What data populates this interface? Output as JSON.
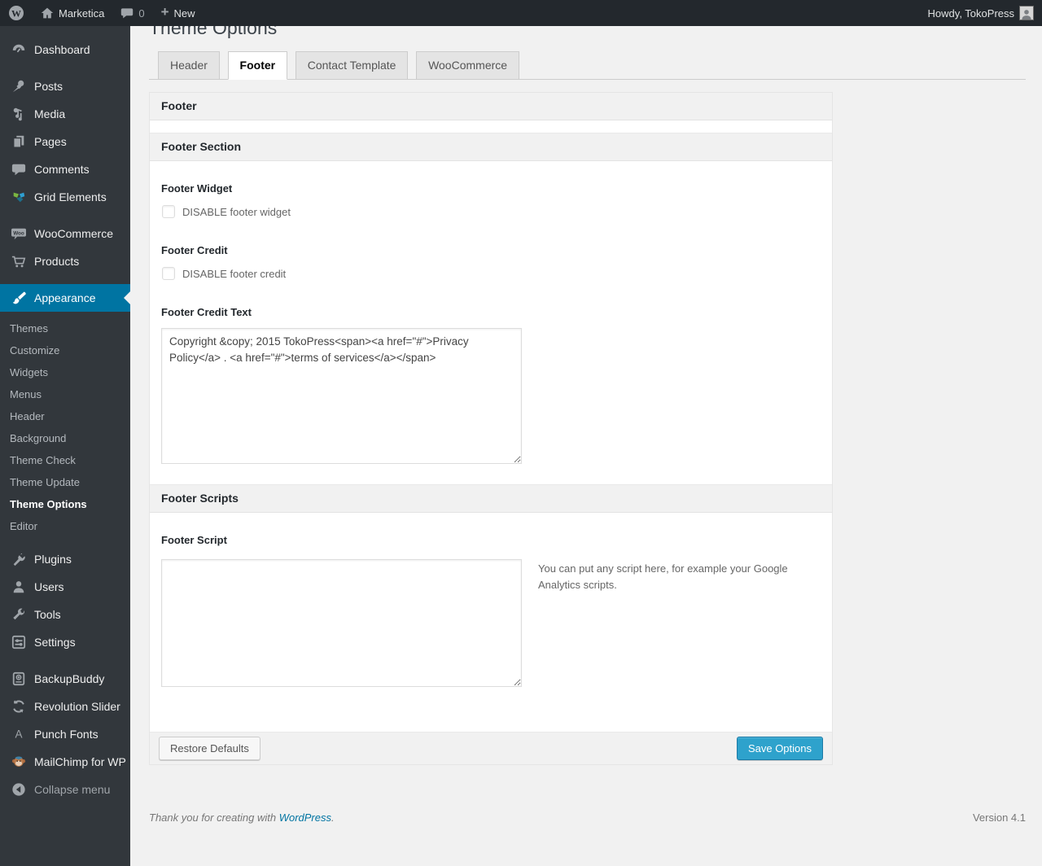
{
  "colors": {
    "accent": "#0074a2",
    "primary_button": "#2ea2cc",
    "adminbar_bg": "#23282d",
    "menu_bg": "#32373c",
    "page_bg": "#f1f1f1"
  },
  "admin_bar": {
    "site_name": "Marketica",
    "comment_count": "0",
    "new_label": "New",
    "howdy_text": "Howdy, TokoPress"
  },
  "sidebar": {
    "items": [
      {
        "label": "Dashboard"
      },
      {
        "label": "Posts"
      },
      {
        "label": "Media"
      },
      {
        "label": "Pages"
      },
      {
        "label": "Comments"
      },
      {
        "label": "Grid Elements"
      },
      {
        "label": "WooCommerce"
      },
      {
        "label": "Products"
      },
      {
        "label": "Appearance",
        "active": true
      },
      {
        "label": "Plugins"
      },
      {
        "label": "Users"
      },
      {
        "label": "Tools"
      },
      {
        "label": "Settings"
      },
      {
        "label": "BackupBuddy"
      },
      {
        "label": "Revolution Slider"
      },
      {
        "label": "Punch Fonts"
      },
      {
        "label": "MailChimp for WP"
      }
    ],
    "appearance_submenu": [
      {
        "label": "Themes"
      },
      {
        "label": "Customize"
      },
      {
        "label": "Widgets"
      },
      {
        "label": "Menus"
      },
      {
        "label": "Header"
      },
      {
        "label": "Background"
      },
      {
        "label": "Theme Check"
      },
      {
        "label": "Theme Update"
      },
      {
        "label": "Theme Options",
        "current": true
      },
      {
        "label": "Editor"
      }
    ],
    "collapse_label": "Collapse menu"
  },
  "page": {
    "title": "Theme Options",
    "tabs": [
      {
        "label": "Header"
      },
      {
        "label": "Footer",
        "active": true
      },
      {
        "label": "Contact Template"
      },
      {
        "label": "WooCommerce"
      }
    ],
    "panel_header": "Footer",
    "footer_section": {
      "header": "Footer Section",
      "footer_widget_label": "Footer Widget",
      "footer_widget_checkbox": "DISABLE footer widget",
      "footer_credit_label": "Footer Credit",
      "footer_credit_checkbox": "DISABLE footer credit",
      "footer_credit_text_label": "Footer Credit Text",
      "footer_credit_text_value": "Copyright &copy; 2015 TokoPress<span><a href=\"#\">Privacy Policy</a> . <a href=\"#\">terms of services</a></span>"
    },
    "footer_scripts": {
      "header": "Footer Scripts",
      "footer_script_label": "Footer Script",
      "footer_script_value": "",
      "footer_script_help": "You can put any script here, for example your Google Analytics scripts."
    },
    "actions": {
      "restore_label": "Restore Defaults",
      "save_label": "Save Options"
    }
  },
  "footer": {
    "thanks_prefix": "Thank you for creating with ",
    "wordpress_link": "WordPress",
    "suffix": ".",
    "version": "Version 4.1"
  }
}
